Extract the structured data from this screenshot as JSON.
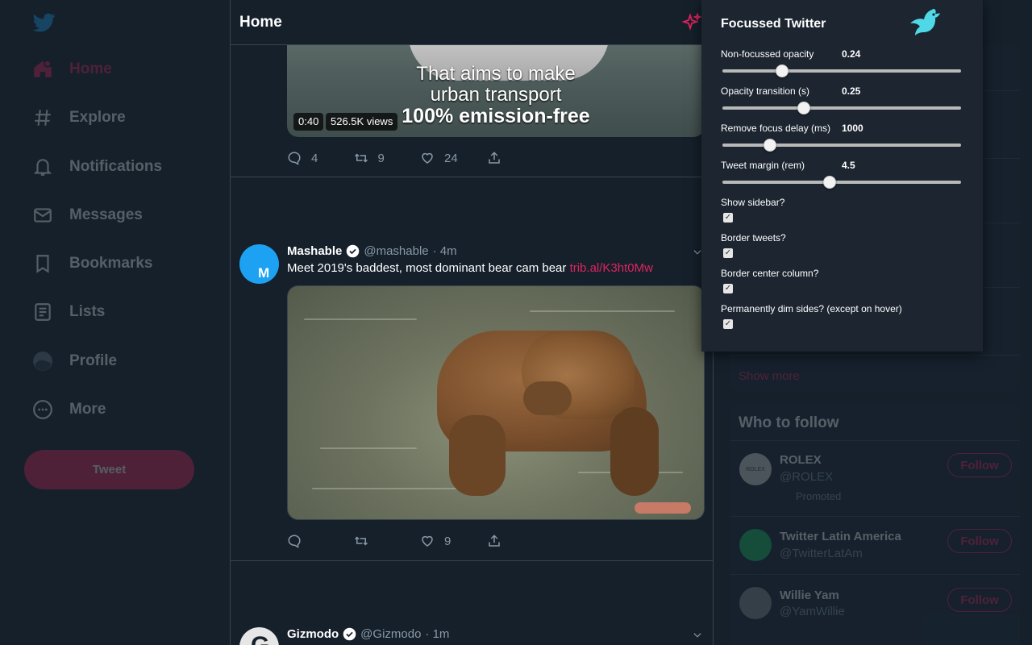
{
  "nav": {
    "items": [
      {
        "label": "Home",
        "icon": "home-icon"
      },
      {
        "label": "Explore",
        "icon": "hashtag-icon"
      },
      {
        "label": "Notifications",
        "icon": "bell-icon"
      },
      {
        "label": "Messages",
        "icon": "envelope-icon"
      },
      {
        "label": "Bookmarks",
        "icon": "bookmark-icon"
      },
      {
        "label": "Lists",
        "icon": "list-icon"
      },
      {
        "label": "Profile",
        "icon": "avatar-icon"
      },
      {
        "label": "More",
        "icon": "more-icon"
      }
    ],
    "tweet_button": "Tweet"
  },
  "header": {
    "title": "Home"
  },
  "video_tweet": {
    "caption_1": "That aims to make",
    "caption_2": "urban transport",
    "caption_3": "100% emission-free",
    "duration": "0:40",
    "views": "526.5K views",
    "replies": "4",
    "retweets": "9",
    "likes": "24"
  },
  "mashable_tweet": {
    "avatar_letter": "M",
    "name": "Mashable",
    "handle": "@mashable",
    "time": "· 4m",
    "text": "Meet 2019's baddest, most dominant bear cam bear ",
    "link": "trib.al/K3ht0Mw",
    "replies": "",
    "retweets": "",
    "likes": "9"
  },
  "gizmodo_tweet": {
    "avatar_letter": "G",
    "name": "Gizmodo",
    "handle": "@Gizmodo",
    "time": "· 1m"
  },
  "sidebar_right": {
    "show_more": "Show more",
    "who_to_follow_title": "Who to follow",
    "accounts": [
      {
        "name": "ROLEX",
        "handle": "@ROLEX",
        "promoted": "Promoted",
        "follow": "Follow",
        "avatar_text": "ROLEX"
      },
      {
        "name": "Twitter Latin America",
        "handle": "@TwitterLatAm",
        "promoted": "",
        "follow": "Follow",
        "avatar_text": ""
      },
      {
        "name": "Willie Yam",
        "handle": "@YamWillie",
        "promoted": "",
        "follow": "Follow",
        "avatar_text": ""
      }
    ]
  },
  "popup": {
    "title": "Focussed Twitter",
    "sliders": [
      {
        "label": "Non-focussed opacity",
        "value": "0.24",
        "fraction": 0.25
      },
      {
        "label": "Opacity transition (s)",
        "value": "0.25",
        "fraction": 0.34
      },
      {
        "label": "Remove focus delay (ms)",
        "value": "1000",
        "fraction": 0.2
      },
      {
        "label": "Tweet margin (rem)",
        "value": "4.5",
        "fraction": 0.45
      }
    ],
    "checkboxes": [
      {
        "label": "Show sidebar?",
        "checked": true
      },
      {
        "label": "Border tweets?",
        "checked": true
      },
      {
        "label": "Border center column?",
        "checked": true
      },
      {
        "label": "Permanently dim sides? (except on hover)",
        "checked": true
      }
    ]
  },
  "colors": {
    "background": "#15202b",
    "accent": "#e0245e",
    "muted": "#8899a6",
    "border": "#38444d",
    "popup_bg": "#1c2530"
  }
}
